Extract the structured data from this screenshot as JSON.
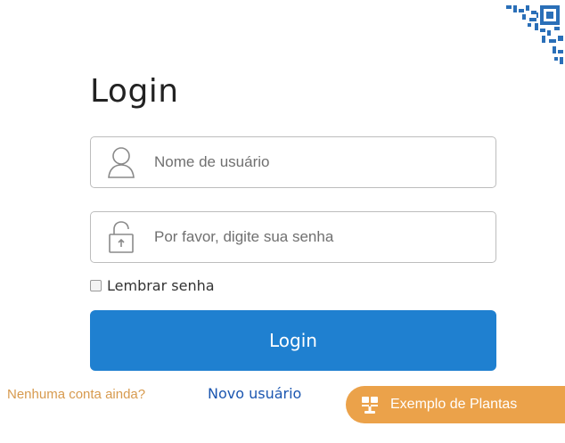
{
  "login": {
    "title": "Login",
    "username": {
      "placeholder": "Nome de usuário",
      "value": "",
      "icon": "user-icon"
    },
    "password": {
      "placeholder": "Por favor, digite sua senha",
      "value": "",
      "icon": "lock-icon"
    },
    "remember": {
      "label": "Lembrar senha",
      "checked": false
    },
    "submit_label": "Login"
  },
  "footer": {
    "no_account_text": "Nenhuma conta ainda?",
    "new_user_link": "Novo usuário",
    "example_button": {
      "label": "Exemplo de Plantas",
      "icon": "plant-icon"
    }
  },
  "colors": {
    "primary": "#1f80d0",
    "accent": "#eba24a",
    "link": "#1b56b0",
    "muted_orange": "#d79a4e"
  }
}
